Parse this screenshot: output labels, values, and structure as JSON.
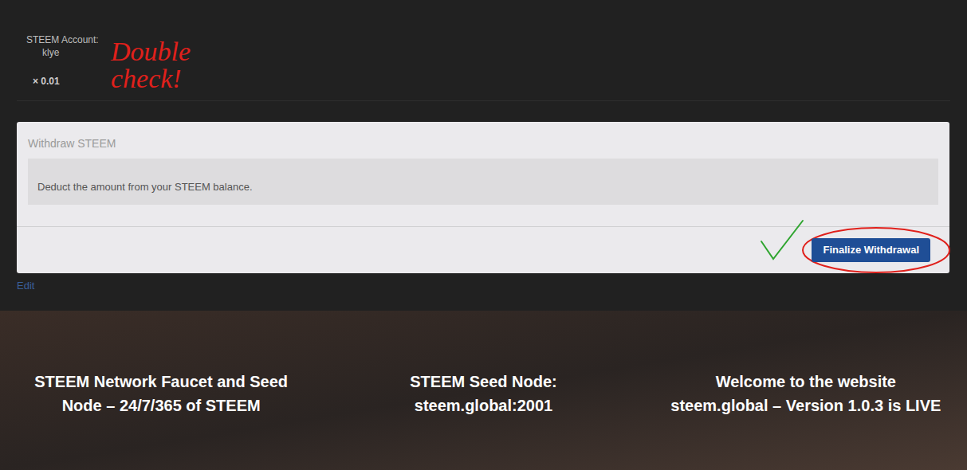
{
  "account": {
    "label": "STEEM Account:",
    "name": "klye",
    "amount": "× 0.01"
  },
  "annotation": {
    "lines": [
      "Double",
      "check!"
    ],
    "color": "#e0201b"
  },
  "withdraw": {
    "title": "Withdraw STEEM",
    "description": "Deduct the amount from your STEEM balance.",
    "button": "Finalize Withdrawal",
    "button_circled": true,
    "checkmark": true
  },
  "edit_link": "Edit",
  "footer": [
    {
      "lines": [
        "STEEM Network Faucet and Seed",
        "Node – 24/7/365 of STEEM"
      ]
    },
    {
      "lines": [
        "STEEM Seed Node:",
        "steem.global:2001"
      ]
    },
    {
      "lines": [
        "Welcome to the website",
        "steem.global – Version 1.0.3 is LIVE"
      ]
    }
  ]
}
